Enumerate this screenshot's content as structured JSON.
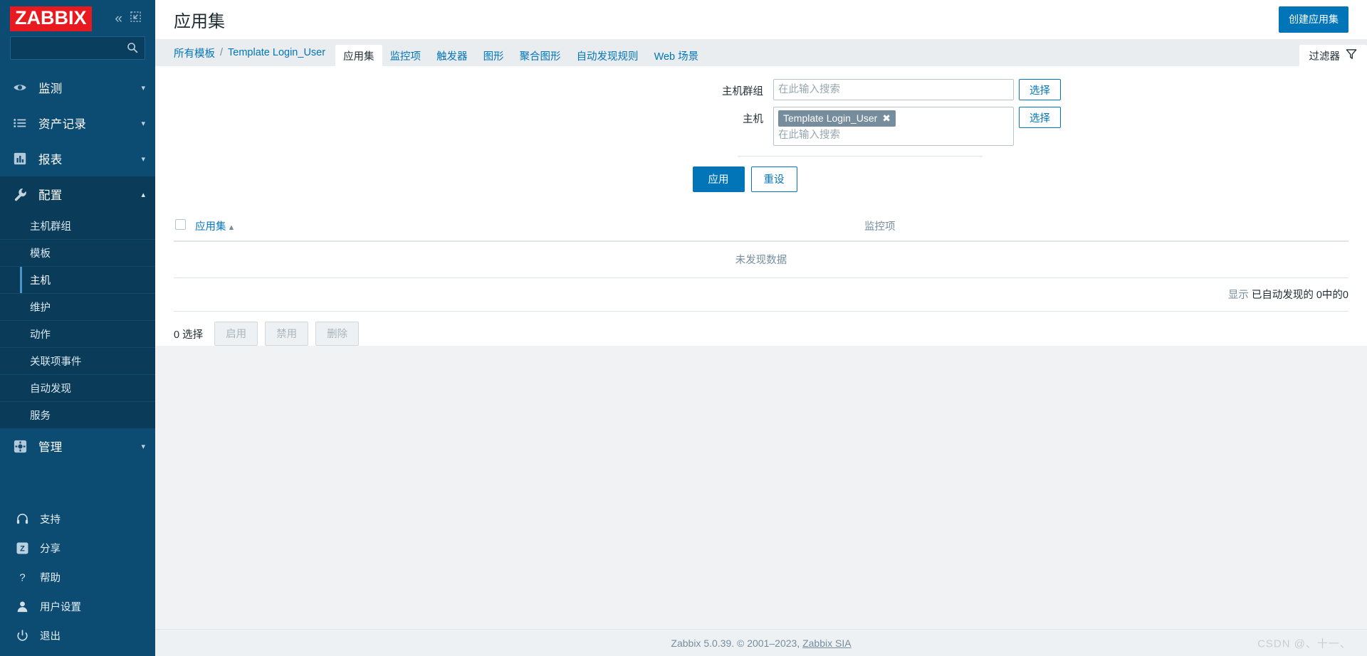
{
  "brand": {
    "logo_text": "ZABBIX",
    "logo_bg": "#e8191f",
    "sidebar_bg": "#0c4b72",
    "accent": "#0275b8"
  },
  "sidebar": {
    "search_placeholder": "",
    "search_value": "",
    "collapse_icon": "chevron-double-left-icon",
    "hide_icon": "collapse-panel-icon",
    "nav": [
      {
        "label": "监测",
        "icon": "eye-icon",
        "expanded": false,
        "active": false
      },
      {
        "label": "资产记录",
        "icon": "list-icon",
        "expanded": false,
        "active": false
      },
      {
        "label": "报表",
        "icon": "bar-chart-icon",
        "expanded": false,
        "active": false
      },
      {
        "label": "配置",
        "icon": "wrench-icon",
        "expanded": true,
        "active": true
      }
    ],
    "submenu": [
      {
        "label": "主机群组",
        "selected": false
      },
      {
        "label": "模板",
        "selected": false
      },
      {
        "label": "主机",
        "selected": true
      },
      {
        "label": "维护",
        "selected": false
      },
      {
        "label": "动作",
        "selected": false
      },
      {
        "label": "关联项事件",
        "selected": false
      },
      {
        "label": "自动发现",
        "selected": false
      },
      {
        "label": "服务",
        "selected": false
      }
    ],
    "nav_admin": {
      "label": "管理",
      "icon": "gear-icon",
      "expanded": false
    },
    "bottom": [
      {
        "label": "支持",
        "icon": "headset-icon"
      },
      {
        "label": "分享",
        "icon": "zabbix-share-icon"
      },
      {
        "label": "帮助",
        "icon": "question-mark-icon"
      },
      {
        "label": "用户设置",
        "icon": "person-icon"
      },
      {
        "label": "退出",
        "icon": "power-icon"
      }
    ]
  },
  "header": {
    "title": "应用集",
    "create_button": "创建应用集"
  },
  "breadcrumb": {
    "root": "所有模板",
    "separator": "/",
    "current": "Template Login_User"
  },
  "tabs": [
    {
      "label": "应用集",
      "active": true
    },
    {
      "label": "监控项",
      "active": false
    },
    {
      "label": "触发器",
      "active": false
    },
    {
      "label": "图形",
      "active": false
    },
    {
      "label": "聚合图形",
      "active": false
    },
    {
      "label": "自动发现规则",
      "active": false
    },
    {
      "label": "Web 场景",
      "active": false
    }
  ],
  "filter_tab": {
    "label": "过滤器",
    "icon": "funnel-icon"
  },
  "filter": {
    "host_group": {
      "label": "主机群组",
      "placeholder": "在此输入搜索",
      "select_button": "选择"
    },
    "host": {
      "label": "主机",
      "placeholder": "在此输入搜索",
      "select_button": "选择",
      "chips": [
        {
          "text": "Template Login_User",
          "remove_icon": "close-x-icon"
        }
      ]
    },
    "apply_button": "应用",
    "reset_button": "重设"
  },
  "table": {
    "columns": [
      {
        "label": "应用集",
        "sorted": true,
        "sort_arrow": "▲"
      },
      {
        "label": "监控项",
        "sorted": false
      }
    ],
    "empty_message": "未发现数据",
    "row_count_prefix": "显示",
    "row_count_text": "已自动发现的 0中的0",
    "rows": []
  },
  "bulk_actions": {
    "selected_text": "0 选择",
    "buttons": [
      {
        "label": "启用",
        "disabled": true
      },
      {
        "label": "禁用",
        "disabled": true
      },
      {
        "label": "删除",
        "disabled": true
      }
    ]
  },
  "footer": {
    "text": "Zabbix 5.0.39. © 2001–2023,",
    "link": "Zabbix SIA",
    "watermark": "CSDN @、十一、"
  }
}
